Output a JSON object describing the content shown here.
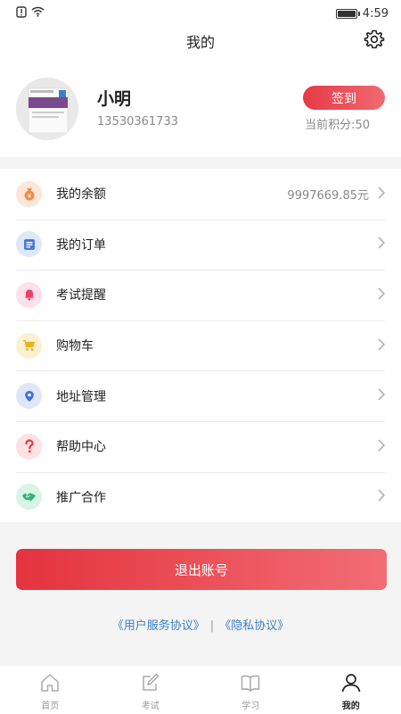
{
  "status": {
    "time": "4:59"
  },
  "header": {
    "title": "我的"
  },
  "profile": {
    "name": "小明",
    "phone": "13530361733",
    "checkin_label": "签到",
    "points_label": "当前积分:50"
  },
  "menu": {
    "items": [
      {
        "label": "我的余额",
        "value": "9997669.85元",
        "icon": "money-bag-icon",
        "color": "#f08a4b"
      },
      {
        "label": "我的订单",
        "value": "",
        "icon": "order-list-icon",
        "color": "#4a78e0"
      },
      {
        "label": "考试提醒",
        "value": "",
        "icon": "bell-icon",
        "color": "#ee3d6c"
      },
      {
        "label": "购物车",
        "value": "",
        "icon": "shopping-cart-icon",
        "color": "#e8b31e"
      },
      {
        "label": "地址管理",
        "value": "",
        "icon": "location-icon",
        "color": "#3f6fe0"
      },
      {
        "label": "帮助中心",
        "value": "",
        "icon": "question-icon",
        "color": "#e6353f"
      },
      {
        "label": "推广合作",
        "value": "",
        "icon": "handshake-icon",
        "color": "#2bb673"
      }
    ]
  },
  "logout_label": "退出账号",
  "agreements": {
    "user_service": "《用户服务协议》",
    "separator": "|",
    "privacy": "《隐私协议》"
  },
  "tabs": [
    {
      "label": "首页",
      "icon": "home-icon",
      "active": false
    },
    {
      "label": "考试",
      "icon": "exam-icon",
      "active": false
    },
    {
      "label": "学习",
      "icon": "book-icon",
      "active": false
    },
    {
      "label": "我的",
      "icon": "user-icon",
      "active": true
    }
  ],
  "colors": {
    "accent": "#e63a46",
    "link": "#3a7fc8"
  }
}
